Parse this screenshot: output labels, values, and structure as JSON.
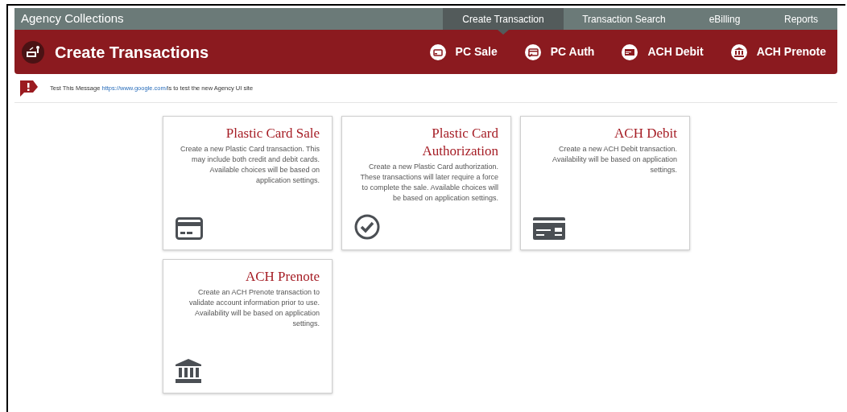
{
  "app_title": "Agency Collections",
  "nav": [
    {
      "label": "Create Transaction",
      "selected": true
    },
    {
      "label": "Transaction Search",
      "selected": false
    },
    {
      "label": "eBilling",
      "selected": false
    },
    {
      "label": "Reports",
      "selected": false
    }
  ],
  "page_title": "Create Transactions",
  "actions": [
    {
      "label": "PC Sale",
      "kind": "card"
    },
    {
      "label": "PC Auth",
      "kind": "card-check"
    },
    {
      "label": "ACH Debit",
      "kind": "ach"
    },
    {
      "label": "ACH Prenote",
      "kind": "bank"
    }
  ],
  "message": {
    "before": "Test This Message ",
    "link": "https://www.google.com/",
    "after": "is to test the new Agency UI site"
  },
  "cards": [
    {
      "title": "Plastic Card Sale",
      "description": "Create a new Plastic Card transaction. This may include both credit and debit cards. Available choices will be based on application settings.",
      "kind": "card"
    },
    {
      "title": "Plastic Card Authorization",
      "description": "Create a new Plastic Card authorization. These transactions will later require a force to complete the sale. Available choices will be based on application settings.",
      "kind": "check"
    },
    {
      "title": "ACH Debit",
      "description": "Create a new ACH Debit transaction. Availability will be based on application settings.",
      "kind": "ach"
    },
    {
      "title": "ACH Prenote",
      "description": "Create an ACH Prenote transaction to validate account information prior to use. Availability will be based on application settings.",
      "kind": "bank"
    }
  ]
}
